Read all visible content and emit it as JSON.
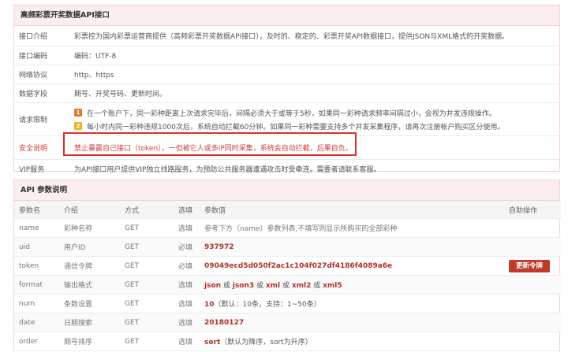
{
  "info_panel": {
    "title": "高频彩票开奖数据API接口",
    "rows": [
      {
        "label": "接口介绍",
        "value": "彩票控为国内彩票运营商提供（高频彩票开奖数据API接口），及时的、稳定的、彩票开奖API数据接口，提供JSON与XML格式的开奖数据。"
      },
      {
        "label": "接口编码",
        "value": "编码：UTF-8"
      },
      {
        "label": "网络协议",
        "value": "http、https"
      },
      {
        "label": "数据字段",
        "value": "期号、开奖号码、更新时间。"
      }
    ],
    "limits": {
      "label": "请求限制",
      "items": [
        {
          "badge": "1",
          "badge_color": "#e8772e",
          "text": "在一个账户下，同一彩种距离上次请求完毕后，间隔必须大于或等于5秒，如果同一彩种请求频率间隔过小，会视为并发违规操作。"
        },
        {
          "badge": "2",
          "badge_color": "#f0b429",
          "text": "每小时内同一彩种违规1000次后，系统自动拦截60分钟。如果同一彩种需要支持多个并发采集程序，请再次注册帐户购买区分使用。"
        }
      ]
    },
    "security": {
      "label": "安全说明",
      "value": "禁止暴露自己接口（token），一但被它人或多IP同时采集，系统会自动拦截，后果自负。"
    },
    "vip": {
      "label": "VIP服务",
      "value": "为API接口用户提供VIP独立线路服务，为预防公共服务器遭遇攻击时受牵连。需要者请联系客服。"
    }
  },
  "params_panel": {
    "title": "API 参数说明",
    "columns": [
      "参数名",
      "介绍",
      "方式",
      "选填",
      "参数值",
      "自助操作"
    ],
    "rows": [
      {
        "name": "name",
        "desc": "彩种名称",
        "method": "GET",
        "req": "选填",
        "value": "参考下方（name）参数列表,不填写则显示所购买的全部彩种",
        "plain": true,
        "action": ""
      },
      {
        "name": "uid",
        "desc": "用户ID",
        "method": "GET",
        "req": "必填",
        "value": "937972",
        "action": ""
      },
      {
        "name": "token",
        "desc": "通信令牌",
        "method": "GET",
        "req": "必填",
        "value": "09049ecd5d050f2ac1c104f027df4186f4089a6e",
        "action": "更新令牌"
      },
      {
        "name": "format",
        "desc": "输出格式",
        "method": "GET",
        "req": "选填",
        "value_parts": [
          "json",
          " 或 ",
          "json3",
          " 或 ",
          "xml",
          " 或 ",
          "xml2",
          " 或 ",
          "xml5"
        ],
        "action": ""
      },
      {
        "name": "num",
        "desc": "条数设置",
        "method": "GET",
        "req": "选填",
        "value_parts": [
          "10",
          "（默认：10条，支持：1~50条）"
        ],
        "action": ""
      },
      {
        "name": "date",
        "desc": "日期搜索",
        "method": "GET",
        "req": "选填",
        "value": "20180127",
        "action": ""
      },
      {
        "name": "order",
        "desc": "期号排序",
        "method": "GET",
        "req": "选填",
        "value_parts": [
          "sort",
          "（默认为降序，sort为升序）"
        ],
        "action": ""
      }
    ]
  }
}
